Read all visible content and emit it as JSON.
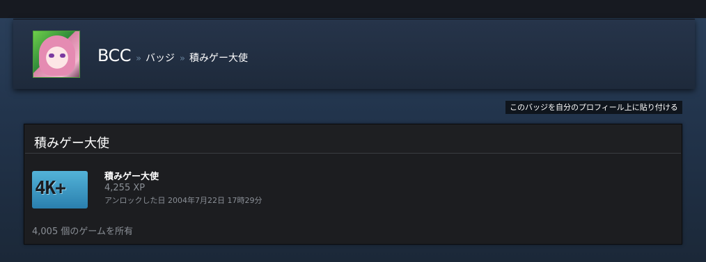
{
  "header": {
    "username": "BCC",
    "sep1": "»",
    "sep2": "»",
    "breadcrumb_badges": "バッジ",
    "breadcrumb_current": "積みゲー大使"
  },
  "pin_button": "このバッジを自分のプロフィール上に貼り付ける",
  "panel": {
    "title": "積みゲー大使",
    "badge": {
      "icon_text": "4K+",
      "name": "積みゲー大使",
      "xp": "4,255 XP",
      "unlocked": "アンロックした日 2004年7月22日 17時29分"
    },
    "games_owned": "4,005 個のゲームを所有"
  },
  "colors": {
    "page_bg": "#1b2838",
    "panel_bg": "#1c1d20",
    "badge_blue": "#53b3d8"
  }
}
